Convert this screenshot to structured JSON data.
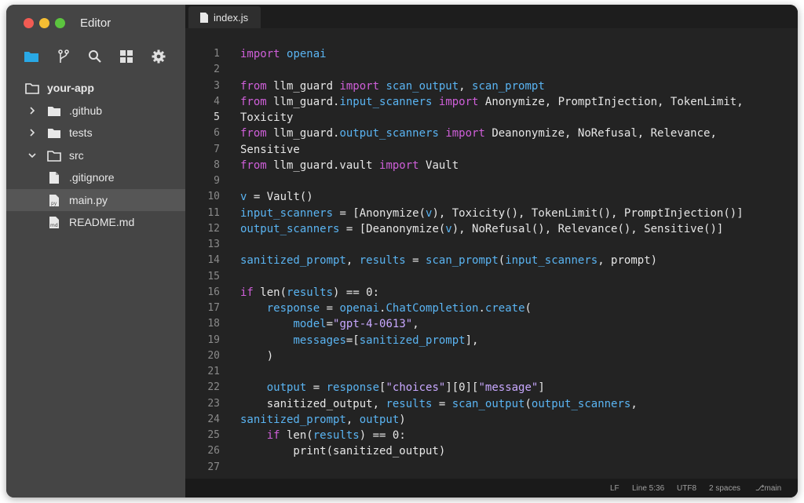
{
  "window": {
    "title": "Editor"
  },
  "activity_bar": [
    {
      "icon": "folder-icon"
    },
    {
      "icon": "git-branch-icon"
    },
    {
      "icon": "search-icon"
    },
    {
      "icon": "extensions-icon"
    },
    {
      "icon": "gear-icon"
    }
  ],
  "explorer": {
    "root": "your-app",
    "items": [
      {
        "label": ".github",
        "type": "folder",
        "expanded": false
      },
      {
        "label": "tests",
        "type": "folder",
        "expanded": false
      },
      {
        "label": "src",
        "type": "folder",
        "expanded": true
      },
      {
        "label": ".gitignore",
        "type": "file"
      },
      {
        "label": "main.py",
        "type": "file",
        "selected": true
      },
      {
        "label": "README.md",
        "type": "file"
      }
    ]
  },
  "tab": {
    "label": "index.js"
  },
  "code": {
    "line_numbers": [
      "1",
      "2",
      "3",
      "4",
      "5",
      "6",
      "7",
      "8",
      "9",
      "10",
      "11",
      "12",
      "13",
      "14",
      "15",
      "16",
      "17",
      "18",
      "19",
      "20",
      "21",
      "22",
      "23",
      "24",
      "25",
      "26",
      "27"
    ],
    "active_line": 5,
    "lines": [
      "import openai",
      "",
      "from llm_guard import scan_output, scan_prompt",
      "from llm_guard.input_scanners import Anonymize, PromptInjection, TokenLimit,",
      "Toxicity",
      "from llm_guard.output_scanners import Deanonymize, NoRefusal, Relevance,",
      "Sensitive",
      "from llm_guard.vault import Vault",
      "",
      "v = Vault()",
      "input_scanners = [Anonymize(v), Toxicity(), TokenLimit(), PromptInjection()]",
      "output_scanners = [Deanonymize(v), NoRefusal(), Relevance(), Sensitive()]",
      "",
      "sanitized_prompt, results = scan_prompt(input_scanners, prompt)",
      "",
      "if len(results) == 0:",
      "    response = openai.ChatCompletion.create(",
      "        model=\"gpt-4-0613\",",
      "        messages=[sanitized_prompt],",
      "    )",
      "",
      "    output = response[\"choices\"][0][\"message\"]",
      "    sanitized_output, results = scan_output(output_scanners,",
      "sanitized_prompt, output)",
      "    if len(results) == 0:",
      "        print(sanitized_output)",
      ""
    ]
  },
  "status": {
    "eol": "LF",
    "position": "Line 5:36",
    "encoding": "UTF8",
    "indent": "2 spaces",
    "branch": "main"
  },
  "colors": {
    "keyword": "#cf5fd9",
    "function": "#5ab4f2",
    "string": "#c8a8ff",
    "background": "#232323",
    "sidebar": "#454545"
  }
}
